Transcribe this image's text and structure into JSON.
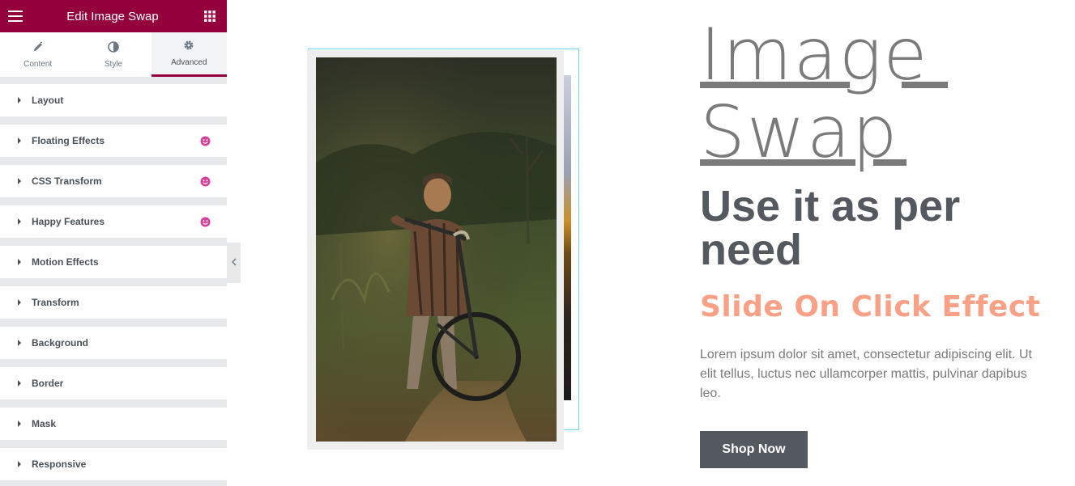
{
  "panel": {
    "title": "Edit Image Swap",
    "menu_icon": "hamburger-icon",
    "apps_icon": "grid-icon",
    "accent": "#93003c",
    "tabs": [
      {
        "label": "Content",
        "icon": "pencil-icon"
      },
      {
        "label": "Style",
        "icon": "half-circle-icon"
      },
      {
        "label": "Advanced",
        "icon": "gear-icon",
        "active": true
      }
    ],
    "sections": [
      {
        "label": "Layout",
        "happy": false
      },
      {
        "label": "Floating Effects",
        "happy": true
      },
      {
        "label": "CSS Transform",
        "happy": true
      },
      {
        "label": "Happy Features",
        "happy": true
      },
      {
        "label": "Motion Effects",
        "happy": false
      },
      {
        "label": "Transform",
        "happy": false
      },
      {
        "label": "Background",
        "happy": false
      },
      {
        "label": "Border",
        "happy": false
      },
      {
        "label": "Mask",
        "happy": false
      },
      {
        "label": "Responsive",
        "happy": false
      }
    ]
  },
  "canvas": {
    "heading_line1": "Image",
    "heading_line2": "Swap",
    "subheading": "Use it as per need",
    "effect_title": "Slide On Click Effect",
    "body": "Lorem ipsum dolor sit amet, consectetur adipiscing elit. Ut elit tellus, luctus nec ullamcorper mattis, pulvinar dapibus leo.",
    "button_label": "Shop Now",
    "colors": {
      "heading": "#7a7a7a",
      "subheading": "#54595f",
      "effect": "#f9a187",
      "button": "#54595f"
    }
  }
}
